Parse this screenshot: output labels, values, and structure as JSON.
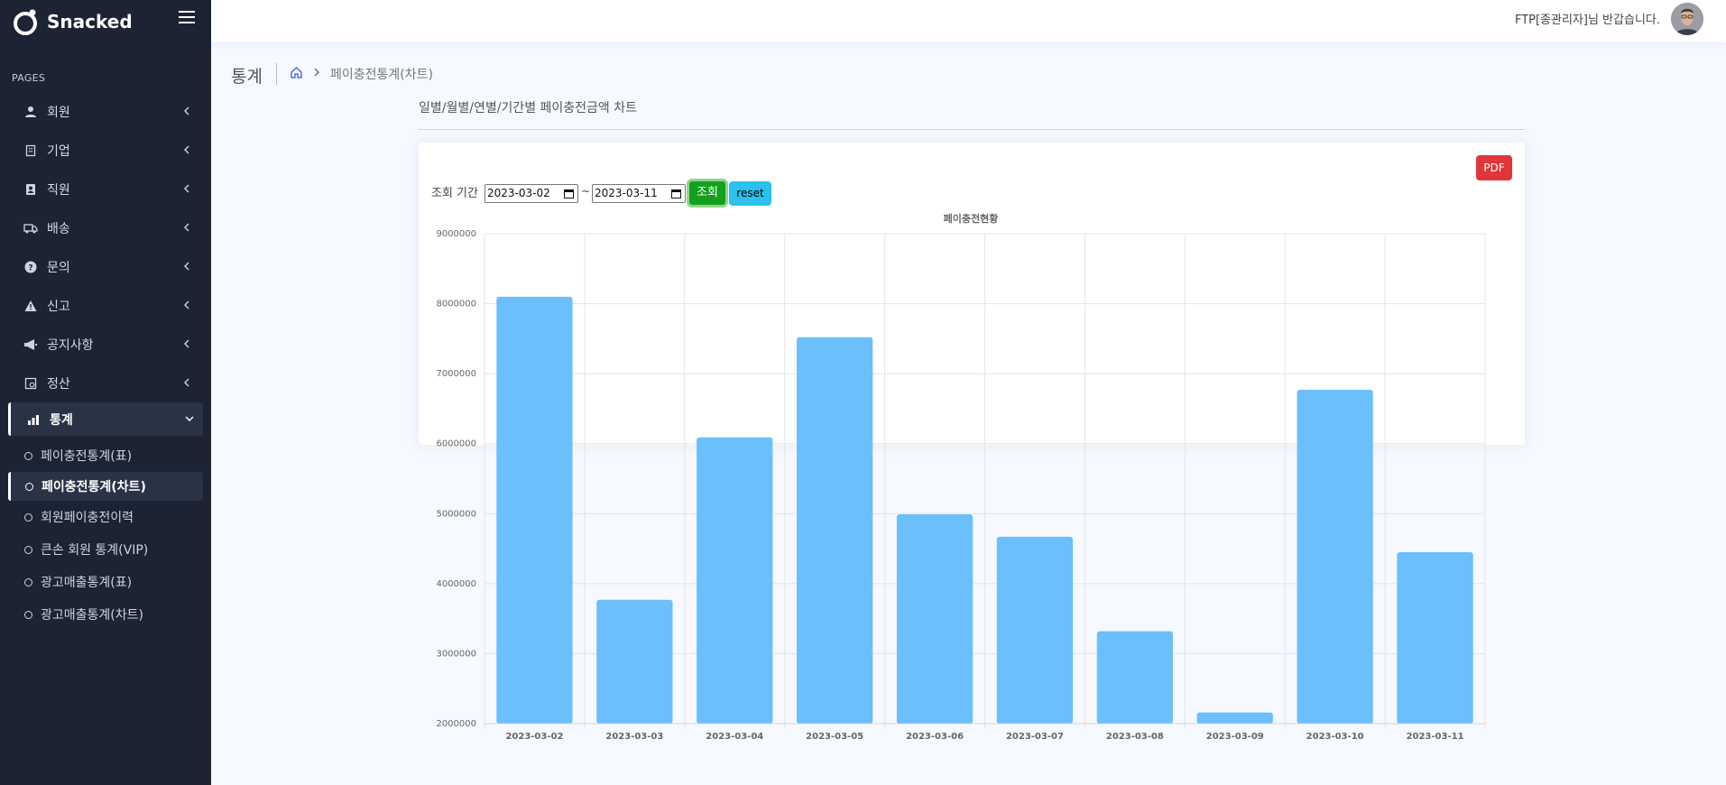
{
  "app": {
    "name": "Snacked"
  },
  "header": {
    "greeting": "FTP[종관리자]님 반갑습니다."
  },
  "sidebar": {
    "section_label": "PAGES",
    "items": [
      {
        "label": "회원",
        "icon": "person-icon"
      },
      {
        "label": "기업",
        "icon": "building-icon"
      },
      {
        "label": "직원",
        "icon": "id-card-icon"
      },
      {
        "label": "배송",
        "icon": "truck-icon"
      },
      {
        "label": "문의",
        "icon": "question-icon"
      },
      {
        "label": "신고",
        "icon": "warning-icon"
      },
      {
        "label": "공지사항",
        "icon": "megaphone-icon"
      },
      {
        "label": "정산",
        "icon": "calculator-icon"
      },
      {
        "label": "통계",
        "icon": "bar-chart-icon",
        "expanded": true
      }
    ],
    "sub_items": [
      {
        "label": "페이충전통계(표)"
      },
      {
        "label": "페이충전통계(차트)",
        "active": true
      },
      {
        "label": "회원페이충전이력"
      },
      {
        "label": "큰손 회원 통계(VIP)"
      },
      {
        "label": "광고매출통계(표)"
      },
      {
        "label": "광고매출통계(차트)"
      }
    ]
  },
  "page": {
    "title": "통계",
    "breadcrumb_current": "페이충전통계(차트)",
    "section_title": "일별/월별/연별/기간별 페이충전금액 차트"
  },
  "filter": {
    "period_label": "조회 기간",
    "start_date": "2023-03-02",
    "end_date": "2023-03-11",
    "separator": "~",
    "search_label": "조회",
    "reset_label": "reset",
    "pdf_label": "PDF"
  },
  "colors": {
    "bar": "#6bbffb",
    "sidebar_bg": "#1c2333",
    "pdf": "#e0363a",
    "search": "#14a01e",
    "reset": "#2cc0ee"
  },
  "chart_data": {
    "type": "bar",
    "title": "페이충전현황",
    "categories": [
      "2023-03-02",
      "2023-03-03",
      "2023-03-04",
      "2023-03-05",
      "2023-03-06",
      "2023-03-07",
      "2023-03-08",
      "2023-03-09",
      "2023-03-10",
      "2023-03-11"
    ],
    "values": [
      8100000,
      3770000,
      6090000,
      7520000,
      4990000,
      4670000,
      3320000,
      2160000,
      6770000,
      4450000
    ],
    "ylim": [
      2000000,
      9000000
    ],
    "yticks": [
      "2000000",
      "3000000",
      "4000000",
      "5000000",
      "6000000",
      "7000000",
      "8000000",
      "9000000"
    ],
    "grid": true,
    "legend": "none"
  }
}
